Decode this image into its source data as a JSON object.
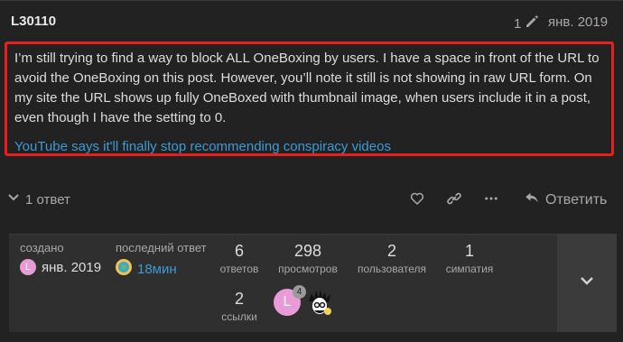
{
  "post": {
    "author": "L30110",
    "edit_count": "1",
    "date": "янв. 2019",
    "body": "I’m still trying to find a way to block ALL OneBoxing by users. I have a space in front of the URL to avoid the OneBoxing on this post. However, you’ll note it still is not showing in raw URL form. On my site the URL shows up fully OneBoxed with thumbnail image, when users include it in a post, even though I have the setting to 0.",
    "link_text": "YouTube says it'll finally stop recommending conspiracy videos",
    "highlight_color": "#e8201c"
  },
  "actions": {
    "replies_label": "1 ответ",
    "reply_button": "Ответить",
    "icons": [
      "heart-icon",
      "link-icon",
      "more-icon",
      "reply-icon"
    ]
  },
  "topic_map": {
    "created_label": "создано",
    "created_avatar_letter": "L",
    "created_value": "янв. 2019",
    "last_reply_label": "последний ответ",
    "last_reply_value": "18мин",
    "stats": [
      {
        "num": "6",
        "label": "ответов"
      },
      {
        "num": "298",
        "label": "просмотров"
      },
      {
        "num": "2",
        "label": "пользователя"
      },
      {
        "num": "1",
        "label": "симпатия"
      },
      {
        "num": "2",
        "label": "ссылки"
      }
    ],
    "participant_letter": "L",
    "participant_count": "4"
  },
  "colors": {
    "link": "#3c9ad6",
    "avatar_pink": "#e89bd6",
    "background": "#222222"
  }
}
